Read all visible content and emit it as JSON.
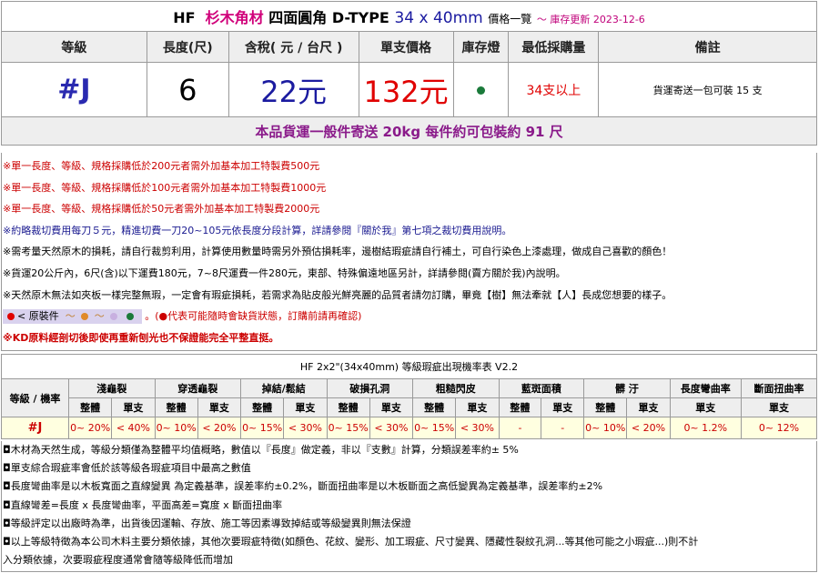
{
  "title": {
    "brand": "HF",
    "wood": "杉木角材",
    "name": "四面圓角 D-TYPE",
    "dimension": "34 x 40mm",
    "price_list": "價格一覽",
    "stock_update": "～ 庫存更新 2023-12-6"
  },
  "headers": {
    "grade": "等級",
    "length": "長度(尺)",
    "price_tax": "含稅( 元 / 台尺 )",
    "single_price": "單支價格",
    "stock_light": "庫存燈",
    "min_qty": "最低採購量",
    "note": "備註"
  },
  "product": {
    "grade": "#J",
    "length": "6",
    "price_tax": "22元",
    "single_price": "132元",
    "stock_color": "#1a7a3a",
    "min_qty": "34支以上",
    "note": "貨運寄送一包可裝 15 支"
  },
  "shipping": "本品貨運一般件寄送 20kg 每件約可包裝約 91 尺",
  "notes": [
    "※單一長度、等級、規格採購低於200元者需外加基本加工特製費500元",
    "※單一長度、等級、規格採購低於100元者需外加基本加工特製費1000元",
    "※單一長度、等級、規格採購低於50元者需外加基本加工特製費2000元",
    "※約略裁切費用每刀５元，精進切費一刀20~105元依長度分段計算，詳請參閱『關於我』第七項之裁切費用說明。",
    "※需考量天然原木的損耗，請自行裁剪利用，計算使用數量時需另外預估損耗率，邊樹結瑕疵請自行補土，可自行染色上漆處理，做成自己喜歡的顏色！",
    "※貨運20公斤內，6尺(含)以下運費180元，7~8尺運費一件280元，東部、特殊偏遠地區另計，詳請參閱(賣方關於我)內說明。",
    "※天然原木無法如夾板一樣完整無瑕，一定會有瑕疵損耗，若需求為貼皮般光鮮亮麗的品質者請勿訂購，畢竟【樹】無法牽就【人】長成您想要的樣子。"
  ],
  "legend": {
    "label": "< 原裝件",
    "tilde": "～",
    "colors": [
      "#e00000",
      "#e08a2a",
      "#c8b0e0",
      "#1a7a3a"
    ],
    "note": "(●代表可能隨時會缺貨狀態，訂購前請再確認)"
  },
  "kd_note": "※KD原料經剖切後即使再重新刨光也不保證能完全平整直挺。",
  "defect_table": {
    "title": "HF 2x2\"(34x40mm) 等級瑕疵出現機率表 V2.2",
    "row_header": "等級 / 機率",
    "columns": [
      "淺龜裂",
      "穿透龜裂",
      "掉結/鬆結",
      "破損孔洞",
      "粗糙閃皮",
      "藍斑面積",
      "髒  汙",
      "長度彎曲率",
      "斷面扭曲率"
    ],
    "sub": {
      "whole": "整體",
      "single": "單支"
    },
    "grade": "#J",
    "values": [
      [
        "0~ 20%",
        "< 40%"
      ],
      [
        "0~ 10%",
        "< 20%"
      ],
      [
        "0~ 15%",
        "< 30%"
      ],
      [
        "0~ 15%",
        "< 30%"
      ],
      [
        "0~ 15%",
        "< 30%"
      ],
      [
        "-",
        "-"
      ],
      [
        "0~ 10%",
        "< 20%"
      ],
      [
        "0~ 1.2%"
      ],
      [
        "0~ 12%"
      ]
    ]
  },
  "remarks": [
    "◘木材為天然生成，等級分類僅為整體平均值概略，數值以『長度』做定義，非以『支數』計算，分類誤差率約± 5%",
    "◘單支綜合瑕疵率會低於該等級各瑕疵項目中最高之數值",
    "◘長度彎曲率是以木板寬面之直線變異 為定義基準，誤差率約±0.2%，斷面扭曲率是以木板斷面之高低變異為定義基準，誤差率約±2%",
    "◘直線彎差=長度 x 長度彎曲率，平面高差=寬度 x 斷面扭曲率",
    "◘等級評定以出廠時為準，出貨後因運輸、存放、施工等因素導致掉結或等級變異則無法保證",
    "◘以上等級特徵為本公司木料主要分類依據，其他次要瑕疵特徵(如顏色、花紋、變形、加工瑕疵、尺寸變異、隱藏性裂紋孔洞...等其他可能之小瑕疵...)則不計",
    "入分類依據，次要瑕疵程度通常會隨等級降低而增加"
  ]
}
